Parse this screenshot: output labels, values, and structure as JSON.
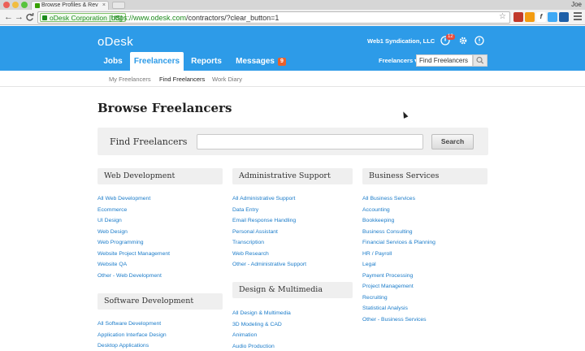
{
  "browser": {
    "tab_title": "Browse Profiles & Reviews",
    "tab_close": "×",
    "profile_name": "Joe",
    "ev_label": "oDesk Corporation [US]",
    "url_host": "https://www.odesk.com",
    "url_path": "/contractors/?clear_button=1",
    "nav_back": "←",
    "nav_forward": "→",
    "nav_reload": "C",
    "bookmark_icon": "star-icon"
  },
  "header": {
    "logo": "oDesk",
    "company": "Web1 Syndication, LLC",
    "notif_count": "12",
    "nav": [
      {
        "label": "Jobs"
      },
      {
        "label": "Freelancers"
      },
      {
        "label": "Reports"
      },
      {
        "label": "Messages",
        "badge": "9"
      }
    ],
    "search_scope": "Freelancers ▾",
    "search_value": "Find Freelancers",
    "accent": "#2d9be8"
  },
  "subnav": [
    "My Freelancers",
    "Find Freelancers",
    "Work Diary"
  ],
  "page": {
    "title": "Browse Freelancers",
    "find_label": "Find Freelancers",
    "search_button": "Search"
  },
  "categories": {
    "web_dev": {
      "title": "Web Development",
      "items": [
        "All Web Development",
        "Ecommerce",
        "UI Design",
        "Web Design",
        "Web Programming",
        "Website Project Management",
        "Website QA",
        "Other - Web Development"
      ]
    },
    "software_dev": {
      "title": "Software Development",
      "items": [
        "All Software Development",
        "Application Interface Design",
        "Desktop Applications"
      ]
    },
    "admin_support": {
      "title": "Administrative Support",
      "items": [
        "All Administrative Support",
        "Data Entry",
        "Email Response Handling",
        "Personal Assistant",
        "Transcription",
        "Web Research",
        "Other - Administrative Support"
      ]
    },
    "design_multimedia": {
      "title": "Design & Multimedia",
      "items": [
        "All Design & Multimedia",
        "3D Modeling & CAD",
        "Animation",
        "Audio Production"
      ]
    },
    "business_services": {
      "title": "Business Services",
      "items": [
        "All Business Services",
        "Accounting",
        "Bookkeeping",
        "Business Consulting",
        "Financial Services & Planning",
        "HR / Payroll",
        "Legal",
        "Payment Processing",
        "Project Management",
        "Recruiting",
        "Statistical Analysis",
        "Other - Business Services"
      ]
    }
  }
}
